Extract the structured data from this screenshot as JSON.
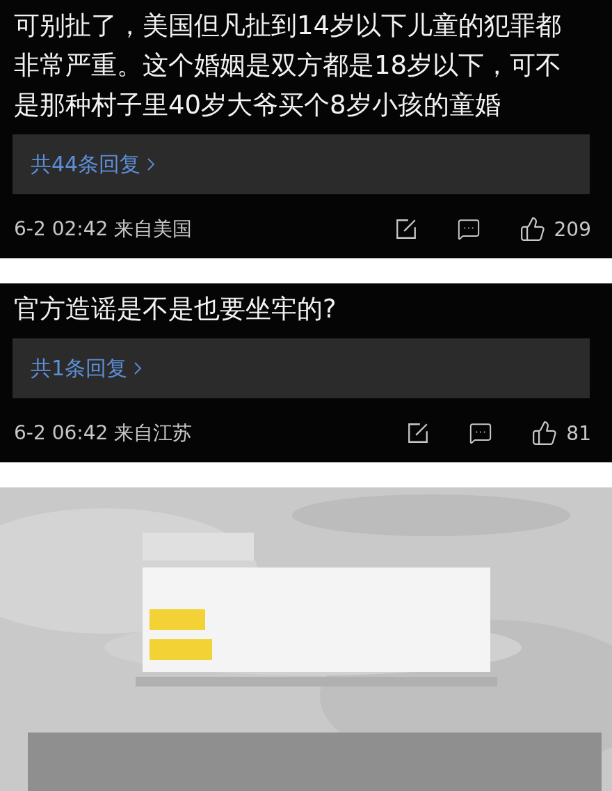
{
  "comments": [
    {
      "text": "可别扯了，美国但凡扯到14岁以下儿童的犯罪都非常严重。这个婚姻是双方都是18岁以下，可不是那种村子里40岁大爷买个8岁小孩的童婚",
      "replies": "共44条回复",
      "meta": "6-2 02:42 来自美国",
      "likes": "209"
    },
    {
      "text": "官方造谣是不是也要坐牢的?",
      "replies": "共1条回复",
      "meta": "6-2 06:42 来自江苏",
      "likes": "81"
    }
  ]
}
